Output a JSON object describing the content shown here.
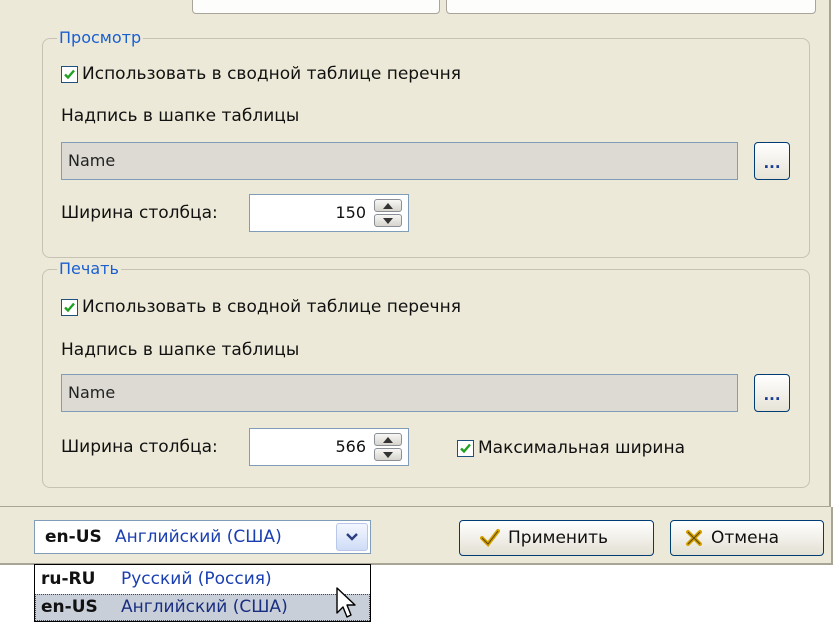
{
  "view_group": {
    "title": "Просмотр",
    "use_in_summary_label": "Использовать в сводной таблице перечня",
    "use_in_summary_checked": true,
    "header_caption_label": "Надпись в шапке таблицы",
    "header_caption_value": "Name",
    "browse_label": "...",
    "column_width_label": "Ширина столбца:",
    "column_width_value": "150"
  },
  "print_group": {
    "title": "Печать",
    "use_in_summary_label": "Использовать в сводной таблице перечня",
    "use_in_summary_checked": true,
    "header_caption_label": "Надпись в шапке таблицы",
    "header_caption_value": "Name",
    "browse_label": "...",
    "column_width_label": "Ширина столбца:",
    "column_width_value": "566",
    "max_width_label": "Максимальная ширина",
    "max_width_checked": true
  },
  "footer": {
    "language_combo": {
      "code": "en-US",
      "name": "Английский (США)"
    },
    "apply_label": "Применить",
    "cancel_label": "Отмена",
    "language_options": [
      {
        "code": "ru-RU",
        "name": "Русский (Россия)"
      },
      {
        "code": "en-US",
        "name": "Английский (США)"
      }
    ]
  },
  "colors": {
    "dialog_bg": "#ece9d8",
    "group_title": "#1a5fd0",
    "checkbox_check": "#21a121",
    "apply_icon": "#d4a000",
    "cancel_icon": "#d4a000"
  },
  "icons": {
    "check": "check-icon",
    "spin_up": "arrow-up-icon",
    "spin_down": "arrow-down-icon",
    "combo_arrow": "chevron-down-icon",
    "apply": "checkmark-icon",
    "cancel": "cross-icon",
    "cursor": "mouse-pointer-icon"
  }
}
